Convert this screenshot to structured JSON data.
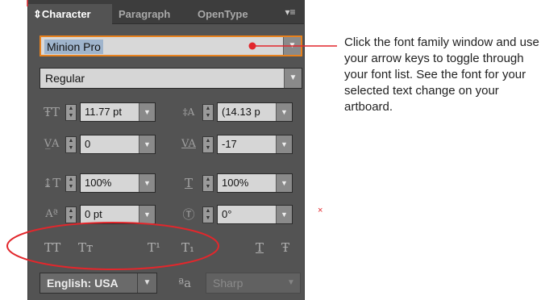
{
  "panel": {
    "tabs": [
      {
        "label": "Character",
        "active": true
      },
      {
        "label": "Paragraph",
        "active": false
      },
      {
        "label": "OpenType",
        "active": false
      }
    ],
    "tab_glyph": "⇕",
    "menu_icon": "panel-menu-icon"
  },
  "font": {
    "family": "Minion Pro",
    "style": "Regular"
  },
  "params": {
    "font_size": {
      "icon": "font-size-icon",
      "value": "11.77 pt"
    },
    "leading": {
      "icon": "leading-icon",
      "value": "(14.13 p"
    },
    "kerning": {
      "icon": "kerning-icon",
      "value": "0"
    },
    "tracking": {
      "icon": "tracking-icon",
      "value": "-17"
    },
    "vertical_scale": {
      "icon": "vertical-scale-icon",
      "value": "100%"
    },
    "horizontal_scale": {
      "icon": "horizontal-scale-icon",
      "value": "100%"
    },
    "baseline_shift": {
      "icon": "baseline-shift-icon",
      "value": "0 pt"
    },
    "character_rotation": {
      "icon": "character-rotation-icon",
      "value": "0°"
    }
  },
  "style_buttons": [
    {
      "name": "all-caps-button",
      "label": "TT"
    },
    {
      "name": "small-caps-button",
      "label": "Tт"
    },
    {
      "name": "superscript-button",
      "label": "T¹"
    },
    {
      "name": "subscript-button",
      "label": "T₁"
    },
    {
      "name": "underline-button",
      "label": "T"
    },
    {
      "name": "strikethrough-button",
      "label": "Ŧ"
    }
  ],
  "language": {
    "value": "English: USA"
  },
  "anti_alias": {
    "icon_label": "ªa",
    "value": "Sharp"
  },
  "annotation": {
    "callout_text": "Click the font family window and use your arrow keys to toggle through your font list. See the font for your selected text change on your artboard.",
    "mark": "×",
    "colors": {
      "ellipse": "#e2272c",
      "pointer": "#e2272c",
      "highlight": "#e8821e"
    }
  }
}
